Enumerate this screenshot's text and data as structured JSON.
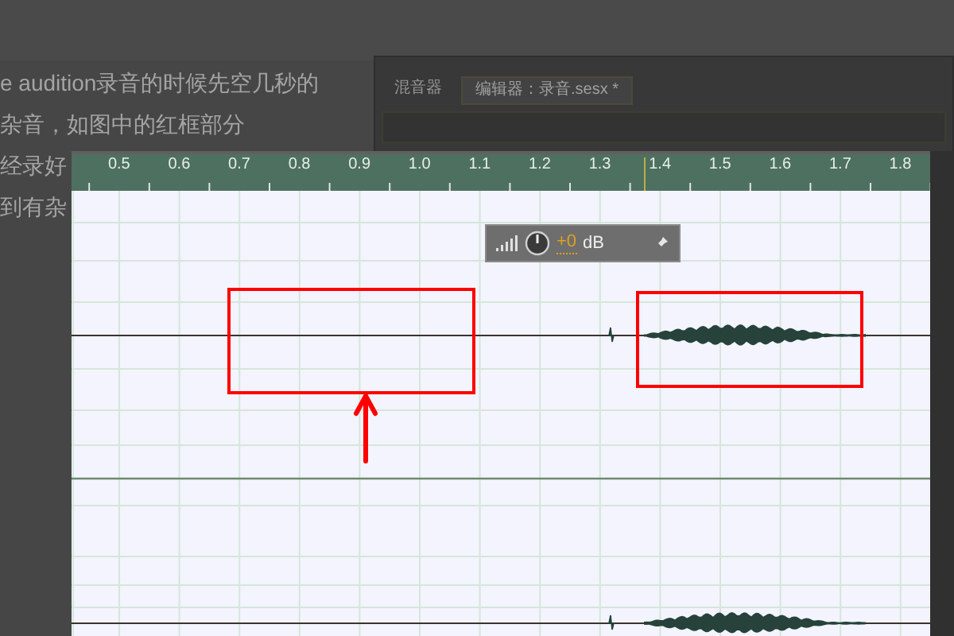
{
  "article": {
    "lines": [
      "e audition录音的时候先空几秒的",
      "杂音，如图中的红框部分",
      "经录好",
      "到有杂"
    ]
  },
  "background_app": {
    "tabs": [
      {
        "label": "混音器",
        "selected": false
      },
      {
        "label": "编辑器：录音.sesx *",
        "selected": true
      }
    ]
  },
  "editor": {
    "ruler": {
      "labels": [
        "0.5",
        "0.6",
        "0.7",
        "0.8",
        "0.9",
        "1.0",
        "1.1",
        "1.2",
        "1.3",
        "1.4",
        "1.5",
        "1.6",
        "1.7",
        "1.8"
      ]
    },
    "gain_hud": {
      "value": "+0",
      "unit": "dB"
    }
  }
}
